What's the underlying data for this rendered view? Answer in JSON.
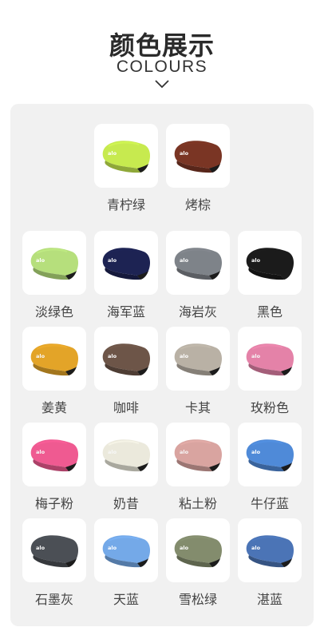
{
  "header": {
    "title_cn": "颜色展示",
    "title_en": "COLOURS",
    "chevron_icon": "chevron-down-icon"
  },
  "brand_mark": "alo",
  "rows": [
    [
      {
        "name": "青柠绿",
        "color": "#c7ea4f"
      },
      {
        "name": "烤棕",
        "color": "#7a3524"
      }
    ],
    [
      {
        "name": "淡绿色",
        "color": "#b6df7c"
      },
      {
        "name": "海军蓝",
        "color": "#1d2353"
      },
      {
        "name": "海岩灰",
        "color": "#7e8389"
      },
      {
        "name": "黑色",
        "color": "#1b1b1b"
      }
    ],
    [
      {
        "name": "姜黄",
        "color": "#e3a428"
      },
      {
        "name": "咖啡",
        "color": "#6d5548"
      },
      {
        "name": "卡其",
        "color": "#b9b1a5"
      },
      {
        "name": "玫粉色",
        "color": "#e482a8"
      }
    ],
    [
      {
        "name": "梅子粉",
        "color": "#ef5a91"
      },
      {
        "name": "奶昔",
        "color": "#ebe9dc"
      },
      {
        "name": "粘土粉",
        "color": "#d9a4a0"
      },
      {
        "name": "牛仔蓝",
        "color": "#4f8ad8"
      }
    ],
    [
      {
        "name": "石墨灰",
        "color": "#4b4f55"
      },
      {
        "name": "天蓝",
        "color": "#74a9e8"
      },
      {
        "name": "雪松绿",
        "color": "#838c6d"
      },
      {
        "name": "湛蓝",
        "color": "#4b74b6"
      }
    ]
  ]
}
